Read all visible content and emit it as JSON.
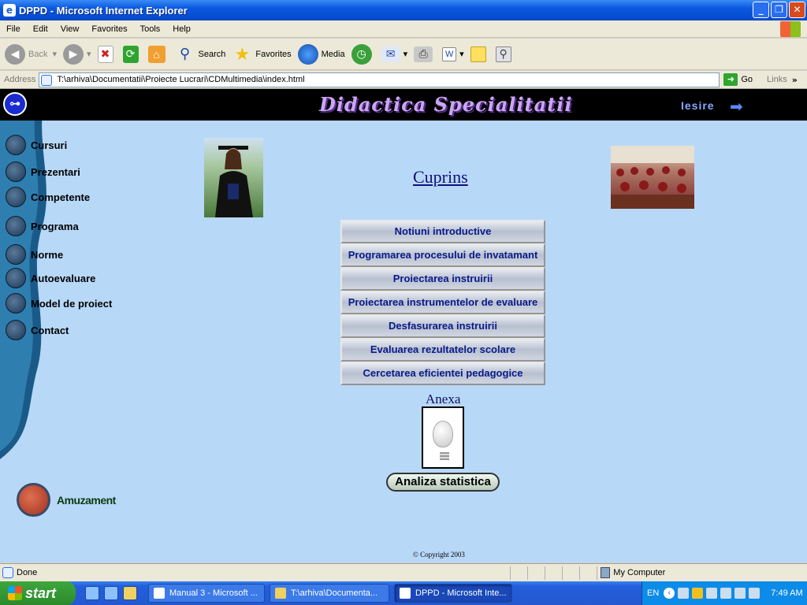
{
  "window": {
    "title": "DPPD - Microsoft Internet Explorer"
  },
  "menu": {
    "items": [
      "File",
      "Edit",
      "View",
      "Favorites",
      "Tools",
      "Help"
    ]
  },
  "toolbar": {
    "back": "Back",
    "search": "Search",
    "favorites": "Favorites",
    "media": "Media"
  },
  "address": {
    "label": "Address",
    "value": "T:\\arhiva\\Documentatii\\Proiecte Lucrari\\CDMultimedia\\index.html",
    "go": "Go",
    "links": "Links"
  },
  "page": {
    "banner": "Didactica Specialitatii",
    "exit": "Iesire",
    "nav": [
      "Cursuri",
      "Prezentari",
      "Competente",
      "Programa",
      "Norme",
      "Autoevaluare",
      "Model de proiect",
      "Contact"
    ],
    "amuzament": "Amuzament",
    "cuprins": "Cuprins",
    "chapters": [
      "Notiuni introductive",
      "Programarea procesului de invatamant",
      "Proiectarea instruirii",
      "Proiectarea instrumentelor de evaluare",
      "Desfasurarea instruirii",
      "Evaluarea rezultatelor scolare",
      "Cercetarea eficientei pedagogice"
    ],
    "anexa": "Anexa",
    "stat_button": "Analiza statistica",
    "copyright": "© Copyright 2003"
  },
  "status": {
    "text": "Done",
    "zone": "My Computer"
  },
  "taskbar": {
    "start": "start",
    "tasks": [
      "Manual 3 - Microsoft ...",
      "T:\\arhiva\\Documenta...",
      "DPPD - Microsoft Inte..."
    ],
    "lang": "EN",
    "clock": "7:49 AM"
  }
}
